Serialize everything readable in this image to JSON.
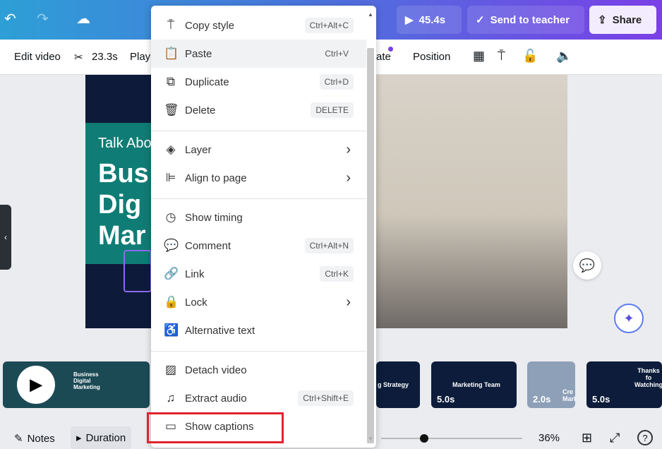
{
  "topbar": {
    "undo": "↶",
    "redo": "↷",
    "cloud": "☁",
    "play_duration": "45.4s",
    "send_to_teacher": "Send to teacher",
    "share": "Share"
  },
  "toolbar": {
    "edit_video": "Edit video",
    "trim_duration": "23.3s",
    "playback": "Play",
    "animate": "ate",
    "position": "Position"
  },
  "slide": {
    "title": "Talk Abo",
    "heading": "Bus\nDig\nMar"
  },
  "menu": {
    "items": [
      {
        "icon": "paint-roller-icon",
        "glyph": "⍑",
        "label": "Copy style",
        "shortcut": "Ctrl+Alt+C"
      },
      {
        "icon": "clipboard-icon",
        "glyph": "📋",
        "label": "Paste",
        "shortcut": "Ctrl+V"
      },
      {
        "icon": "duplicate-icon",
        "glyph": "⧉",
        "label": "Duplicate",
        "shortcut": "Ctrl+D"
      },
      {
        "icon": "trash-icon",
        "glyph": "🗑",
        "label": "Delete",
        "shortcut": "DELETE"
      },
      {
        "icon": "layers-icon",
        "glyph": "◈",
        "label": "Layer"
      },
      {
        "icon": "align-icon",
        "glyph": "⊫",
        "label": "Align to page"
      },
      {
        "icon": "clock-icon",
        "glyph": "◷",
        "label": "Show timing"
      },
      {
        "icon": "comment-icon",
        "glyph": "💬",
        "label": "Comment",
        "shortcut": "Ctrl+Alt+N"
      },
      {
        "icon": "link-icon",
        "glyph": "🔗",
        "label": "Link",
        "shortcut": "Ctrl+K"
      },
      {
        "icon": "lock-icon",
        "glyph": "🔒",
        "label": "Lock"
      },
      {
        "icon": "accessibility-icon",
        "glyph": "♿",
        "label": "Alternative text"
      },
      {
        "icon": "detach-icon",
        "glyph": "▨",
        "label": "Detach video"
      },
      {
        "icon": "music-icon",
        "glyph": "♫",
        "label": "Extract audio",
        "shortcut": "Ctrl+Shift+E"
      },
      {
        "icon": "captions-icon",
        "glyph": "▭",
        "label": "Show captions"
      }
    ]
  },
  "timeline": {
    "clips": [
      {
        "text": "g Strategy",
        "duration": ""
      },
      {
        "text": "Marketing Team",
        "duration": "5.0s"
      },
      {
        "text": "Cre Mark",
        "duration": "2.0s"
      },
      {
        "text": "Thanks fo Watching",
        "duration": "5.0s"
      }
    ],
    "first_clip_text": "Business Digital Marketing"
  },
  "bottombar": {
    "notes": "Notes",
    "duration": "Duration",
    "zoom": "36%",
    "zoom_level": 36
  },
  "colors": {
    "accent": "#7a3fe6",
    "highlight": "#e0232e"
  }
}
